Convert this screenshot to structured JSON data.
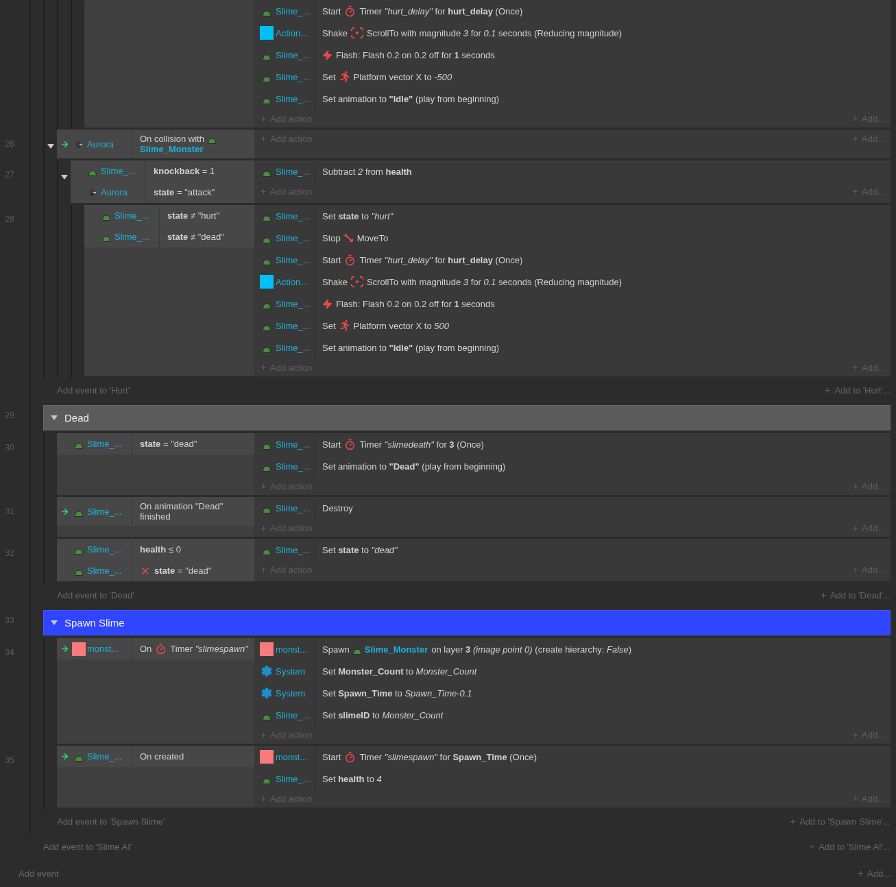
{
  "sheet": {
    "add_event": "Add event",
    "add_to": "Add...",
    "groups": [
      {
        "add_event": "Add event to 'Slime AI'",
        "add_to": "Add to 'Slime AI'...",
        "children": [
          {
            "kind": "group",
            "add_event": "Add event to 'Hurt'",
            "add_to": "Add to 'Hurt'...",
            "children": [
              {
                "kind": "event",
                "children": [
                  {
                    "kind": "event",
                    "children": [
                      {
                        "kind": "event",
                        "add_action": "Add action",
                        "add_to": "Add...",
                        "actions": [
                          {
                            "object": "Slime_...",
                            "kind": "slime",
                            "segments": [
                              {
                                "kind": "text",
                                "text": "Start"
                              },
                              {
                                "kind": "timer"
                              },
                              {
                                "kind": "text",
                                "text": "Timer *\"hurt_delay\"* for **hurt_delay** (Once)"
                              }
                            ]
                          },
                          {
                            "object": "Action...",
                            "kind": "square",
                            "segments": [
                              {
                                "kind": "text",
                                "text": "Shake"
                              },
                              {
                                "kind": "scroll"
                              },
                              {
                                "kind": "text",
                                "text": "ScrollTo with magnitude *3* for *0.1* seconds (Reducing magnitude)"
                              }
                            ]
                          },
                          {
                            "object": "Slime_...",
                            "kind": "slime",
                            "segments": [
                              {
                                "kind": "flash"
                              },
                              {
                                "kind": "text",
                                "text": "Flash: Flash 0.2 on 0.2 off for **1** seconds"
                              }
                            ]
                          },
                          {
                            "object": "Slime_...",
                            "kind": "slime",
                            "segments": [
                              {
                                "kind": "text",
                                "text": "Set"
                              },
                              {
                                "kind": "platform"
                              },
                              {
                                "kind": "text",
                                "text": "Platform vector X to *-500*"
                              }
                            ]
                          },
                          {
                            "object": "Slime_...",
                            "kind": "slime",
                            "segments": [
                              {
                                "kind": "text",
                                "text": "Set animation to **\"Idle\"** (play from beginning)"
                              }
                            ]
                          }
                        ]
                      }
                    ]
                  }
                ]
              },
              {
                "kind": "event",
                "number": "26",
                "trigger": true,
                "expanded": true,
                "add_action": "Add action",
                "add_to": "Add...",
                "conditions": [
                  {
                    "object": "Aurora",
                    "kind": "aurora",
                    "inverted": false,
                    "segments": [
                      {
                        "kind": "text",
                        "text": "On collision with"
                      },
                      {
                        "kind": "slime"
                      },
                      {
                        "kind": "link",
                        "text": "Slime_Monster"
                      }
                    ]
                  }
                ],
                "children": [
                  {
                    "kind": "event",
                    "number": "27",
                    "trigger": false,
                    "expanded": true,
                    "add_action": "Add action",
                    "add_to": "Add...",
                    "conditions": [
                      {
                        "object": "Slime_...",
                        "kind": "slime",
                        "inverted": false,
                        "segments": [
                          {
                            "kind": "text",
                            "text": "**knockback** = 1"
                          }
                        ]
                      },
                      {
                        "object": "Aurora",
                        "kind": "aurora",
                        "inverted": false,
                        "segments": [
                          {
                            "kind": "text",
                            "text": "**state** = \"attack\""
                          }
                        ]
                      }
                    ],
                    "actions": [
                      {
                        "object": "Slime_...",
                        "kind": "slime",
                        "segments": [
                          {
                            "kind": "text",
                            "text": "Subtract *2* from **health**"
                          }
                        ]
                      }
                    ],
                    "children": [
                      {
                        "kind": "event",
                        "number": "28",
                        "trigger": false,
                        "add_action": "Add action",
                        "add_to": "Add...",
                        "conditions": [
                          {
                            "object": "Slime_...",
                            "kind": "slime",
                            "inverted": false,
                            "segments": [
                              {
                                "kind": "text",
                                "text": "**state** ≠ \"hurt\""
                              }
                            ]
                          },
                          {
                            "object": "Slime_...",
                            "kind": "slime",
                            "inverted": false,
                            "segments": [
                              {
                                "kind": "text",
                                "text": "**state** ≠ \"dead\""
                              }
                            ]
                          }
                        ],
                        "actions": [
                          {
                            "object": "Slime_...",
                            "kind": "slime",
                            "segments": [
                              {
                                "kind": "text",
                                "text": "Set **state** to *\"hurt\"*"
                              }
                            ]
                          },
                          {
                            "object": "Slime_...",
                            "kind": "slime",
                            "segments": [
                              {
                                "kind": "text",
                                "text": "Stop"
                              },
                              {
                                "kind": "moveto"
                              },
                              {
                                "kind": "text",
                                "text": "MoveTo"
                              }
                            ]
                          },
                          {
                            "object": "Slime_...",
                            "kind": "slime",
                            "segments": [
                              {
                                "kind": "text",
                                "text": "Start"
                              },
                              {
                                "kind": "timer"
                              },
                              {
                                "kind": "text",
                                "text": "Timer *\"hurt_delay\"* for **hurt_delay** (Once)"
                              }
                            ]
                          },
                          {
                            "object": "Action...",
                            "kind": "square",
                            "segments": [
                              {
                                "kind": "text",
                                "text": "Shake"
                              },
                              {
                                "kind": "scroll"
                              },
                              {
                                "kind": "text",
                                "text": "ScrollTo with magnitude *3* for *0.1* seconds (Reducing magnitude)"
                              }
                            ]
                          },
                          {
                            "object": "Slime_...",
                            "kind": "slime",
                            "segments": [
                              {
                                "kind": "flash"
                              },
                              {
                                "kind": "text",
                                "text": "Flash: Flash 0.2 on 0.2 off for **1** seconds"
                              }
                            ]
                          },
                          {
                            "object": "Slime_...",
                            "kind": "slime",
                            "segments": [
                              {
                                "kind": "text",
                                "text": "Set"
                              },
                              {
                                "kind": "platform"
                              },
                              {
                                "kind": "text",
                                "text": "Platform vector X to *500*"
                              }
                            ]
                          },
                          {
                            "object": "Slime_...",
                            "kind": "slime",
                            "segments": [
                              {
                                "kind": "text",
                                "text": "Set animation to **\"Idle\"** (play from beginning)"
                              }
                            ]
                          }
                        ]
                      }
                    ]
                  }
                ]
              }
            ]
          },
          {
            "kind": "group",
            "number": "29",
            "title": "Dead",
            "selected": false,
            "expanded": true,
            "add_event": "Add event to 'Dead'",
            "add_to": "Add to 'Dead'...",
            "children": [
              {
                "kind": "event",
                "number": "30",
                "trigger": false,
                "add_action": "Add action",
                "add_to": "Add...",
                "conditions": [
                  {
                    "object": "Slime_...",
                    "kind": "slime",
                    "inverted": false,
                    "segments": [
                      {
                        "kind": "text",
                        "text": "**state** = \"dead\""
                      }
                    ]
                  }
                ],
                "actions": [
                  {
                    "object": "Slime_...",
                    "kind": "slime",
                    "segments": [
                      {
                        "kind": "text",
                        "text": "Start"
                      },
                      {
                        "kind": "timer"
                      },
                      {
                        "kind": "text",
                        "text": "Timer *\"slimedeath\"* for **3** (Once)"
                      }
                    ]
                  },
                  {
                    "object": "Slime_...",
                    "kind": "slime",
                    "segments": [
                      {
                        "kind": "text",
                        "text": "Set animation to **\"Dead\"** (play from beginning)"
                      }
                    ]
                  }
                ]
              },
              {
                "kind": "event",
                "number": "31",
                "trigger": true,
                "add_action": "Add action",
                "add_to": "Add...",
                "conditions": [
                  {
                    "object": "Slime_...",
                    "kind": "slime",
                    "inverted": false,
                    "segments": [
                      {
                        "kind": "text",
                        "text": "On animation \"Dead\" finished"
                      }
                    ]
                  }
                ],
                "actions": [
                  {
                    "object": "Slime_...",
                    "kind": "slime",
                    "segments": [
                      {
                        "kind": "text",
                        "text": "Destroy"
                      }
                    ]
                  }
                ]
              },
              {
                "kind": "event",
                "number": "32",
                "trigger": false,
                "add_action": "Add action",
                "add_to": "Add...",
                "conditions": [
                  {
                    "object": "Slime_...",
                    "kind": "slime",
                    "inverted": false,
                    "segments": [
                      {
                        "kind": "text",
                        "text": "**health** ≤ 0"
                      }
                    ]
                  },
                  {
                    "object": "Slime_...",
                    "kind": "slime",
                    "inverted": true,
                    "segments": [
                      {
                        "kind": "text",
                        "text": "**state** = \"dead\""
                      }
                    ]
                  }
                ],
                "actions": [
                  {
                    "object": "Slime_...",
                    "kind": "slime",
                    "segments": [
                      {
                        "kind": "text",
                        "text": "Set **state** to *\"dead\"*"
                      }
                    ]
                  }
                ]
              }
            ]
          },
          {
            "kind": "group",
            "number": "33",
            "title": "Spawn Slime",
            "selected": true,
            "expanded": true,
            "add_event": "Add event to 'Spawn Slime'",
            "add_to": "Add to 'Spawn Slime'...",
            "children": [
              {
                "kind": "event",
                "number": "34",
                "trigger": true,
                "add_action": "Add action",
                "add_to": "Add...",
                "conditions": [
                  {
                    "object": "monst...",
                    "kind": "monster",
                    "inverted": false,
                    "segments": [
                      {
                        "kind": "text",
                        "text": "On"
                      },
                      {
                        "kind": "timer"
                      },
                      {
                        "kind": "text",
                        "text": "Timer *\"slimespawn\"*"
                      }
                    ]
                  }
                ],
                "actions": [
                  {
                    "object": "monst...",
                    "kind": "monster",
                    "segments": [
                      {
                        "kind": "text",
                        "text": "Spawn"
                      },
                      {
                        "kind": "slime"
                      },
                      {
                        "kind": "link",
                        "text": "Slime_Monster"
                      },
                      {
                        "kind": "text",
                        "text": "on layer **3** *(image point 0)* (create hierarchy: *False*)"
                      }
                    ]
                  },
                  {
                    "object": "System",
                    "kind": "system",
                    "segments": [
                      {
                        "kind": "text",
                        "text": "Set **Monster_Count** to *Monster_Count*"
                      }
                    ]
                  },
                  {
                    "object": "System",
                    "kind": "system",
                    "segments": [
                      {
                        "kind": "text",
                        "text": "Set **Spawn_Time** to *Spawn_Time-0.1*"
                      }
                    ]
                  },
                  {
                    "object": "Slime_...",
                    "kind": "slime",
                    "segments": [
                      {
                        "kind": "text",
                        "text": "Set **slimeID** to *Monster_Count*"
                      }
                    ]
                  }
                ]
              },
              {
                "kind": "event",
                "number": "35",
                "trigger": true,
                "add_action": "Add action",
                "add_to": "Add...",
                "conditions": [
                  {
                    "object": "Slime_...",
                    "kind": "slime",
                    "inverted": false,
                    "segments": [
                      {
                        "kind": "text",
                        "text": "On created"
                      }
                    ]
                  }
                ],
                "actions": [
                  {
                    "object": "monst...",
                    "kind": "monster",
                    "segments": [
                      {
                        "kind": "text",
                        "text": "Start"
                      },
                      {
                        "kind": "timer"
                      },
                      {
                        "kind": "text",
                        "text": "Timer *\"slimespawn\"* for **Spawn_Time** (Once)"
                      }
                    ]
                  },
                  {
                    "object": "Slime_...",
                    "kind": "slime",
                    "segments": [
                      {
                        "kind": "text",
                        "text": "Set **health** to *4*"
                      }
                    ]
                  }
                ]
              }
            ]
          }
        ]
      }
    ]
  }
}
